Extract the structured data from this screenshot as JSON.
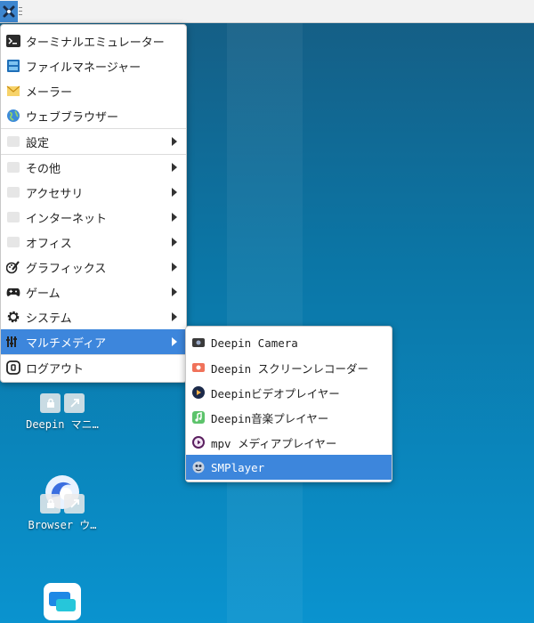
{
  "main_menu": {
    "items": [
      {
        "label": "ターミナルエミュレーター",
        "icon": "terminal-icon"
      },
      {
        "label": "ファイルマネージャー",
        "icon": "file-manager-icon"
      },
      {
        "label": "メーラー",
        "icon": "mail-icon"
      },
      {
        "label": "ウェブブラウザー",
        "icon": "globe-icon"
      },
      {
        "label": "設定",
        "icon": "settings-placeholder-icon"
      },
      {
        "label": "その他",
        "icon": "other-placeholder-icon"
      },
      {
        "label": "アクセサリ",
        "icon": "accessories-placeholder-icon"
      },
      {
        "label": "インターネット",
        "icon": "internet-placeholder-icon"
      },
      {
        "label": "オフィス",
        "icon": "office-placeholder-icon"
      },
      {
        "label": "グラフィックス",
        "icon": "graphics-icon"
      },
      {
        "label": "ゲーム",
        "icon": "gamepad-icon"
      },
      {
        "label": "システム",
        "icon": "gear-icon"
      },
      {
        "label": "マルチメディア",
        "icon": "multimedia-icon"
      },
      {
        "label": "ログアウト",
        "icon": "logout-icon"
      }
    ]
  },
  "multimedia_menu": {
    "items": [
      {
        "label": "Deepin Camera",
        "icon": "camera-icon"
      },
      {
        "label": "Deepin スクリーンレコーダー",
        "icon": "screen-recorder-icon"
      },
      {
        "label": "Deepinビデオプレイヤー",
        "icon": "video-player-icon"
      },
      {
        "label": "Deepin音楽プレイヤー",
        "icon": "music-player-icon"
      },
      {
        "label": "mpv メディアプレイヤー",
        "icon": "mpv-icon"
      },
      {
        "label": "SMPlayer",
        "icon": "smplayer-icon"
      }
    ]
  },
  "desktop": {
    "icons": [
      {
        "label": "Deepin マニ…"
      },
      {
        "label": "Browser ウ…"
      },
      {
        "label": ""
      }
    ]
  },
  "colors": {
    "accent": "#3d86dc",
    "menu_bg": "#ffffff",
    "panel_bg": "#f2f2f2"
  }
}
